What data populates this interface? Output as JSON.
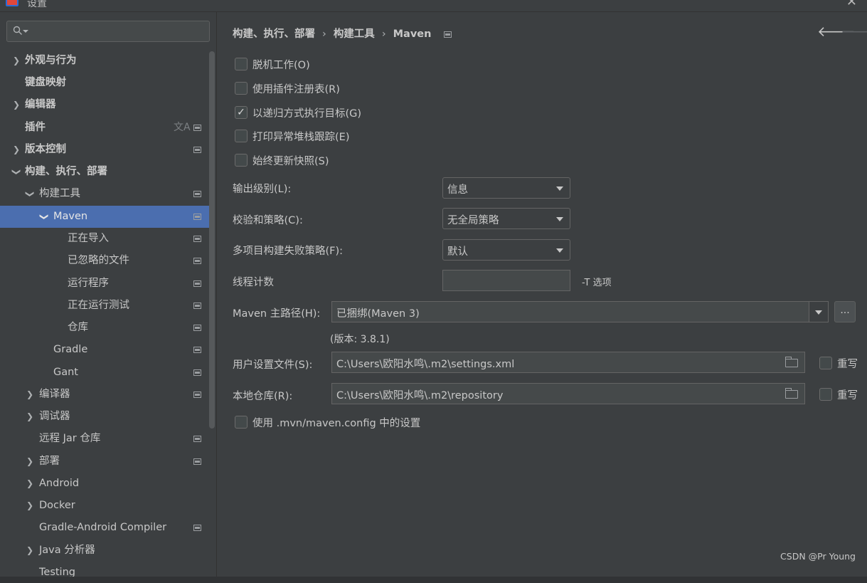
{
  "window": {
    "title": "设置"
  },
  "search": {
    "placeholder": ""
  },
  "sidebar": {
    "items": [
      {
        "label": "外观与行为",
        "bold": true,
        "chevron": "right"
      },
      {
        "label": "键盘映射",
        "bold": true,
        "chevron": ""
      },
      {
        "label": "编辑器",
        "bold": true,
        "chevron": "right"
      },
      {
        "label": "插件",
        "bold": true,
        "chevron": ""
      },
      {
        "label": "版本控制",
        "bold": true,
        "chevron": "right"
      },
      {
        "label": "构建、执行、部署",
        "bold": true,
        "chevron": "down"
      },
      {
        "label": "构建工具",
        "bold": false,
        "chevron": "down"
      },
      {
        "label": "Maven",
        "bold": false,
        "chevron": "down"
      },
      {
        "label": "正在导入",
        "bold": false,
        "chevron": ""
      },
      {
        "label": "已忽略的文件",
        "bold": false,
        "chevron": ""
      },
      {
        "label": "运行程序",
        "bold": false,
        "chevron": ""
      },
      {
        "label": "正在运行测试",
        "bold": false,
        "chevron": ""
      },
      {
        "label": "仓库",
        "bold": false,
        "chevron": ""
      },
      {
        "label": "Gradle",
        "bold": false,
        "chevron": ""
      },
      {
        "label": "Gant",
        "bold": false,
        "chevron": ""
      },
      {
        "label": "编译器",
        "bold": false,
        "chevron": "right"
      },
      {
        "label": "调试器",
        "bold": false,
        "chevron": "right"
      },
      {
        "label": "远程 Jar 仓库",
        "bold": false,
        "chevron": ""
      },
      {
        "label": "部署",
        "bold": false,
        "chevron": "right"
      },
      {
        "label": "Android",
        "bold": false,
        "chevron": "right"
      },
      {
        "label": "Docker",
        "bold": false,
        "chevron": "right"
      },
      {
        "label": "Gradle-Android Compiler",
        "bold": false,
        "chevron": ""
      },
      {
        "label": "Java 分析器",
        "bold": false,
        "chevron": "right"
      },
      {
        "label": "Testing",
        "bold": false,
        "chevron": ""
      }
    ]
  },
  "breadcrumb": {
    "part1": "构建、执行、部署",
    "sep": "›",
    "part2": "构建工具",
    "part3": "Maven"
  },
  "nav": {
    "back": "🡐",
    "forward": "🡒"
  },
  "options": {
    "offline": {
      "label": "脱机工作(O)",
      "checked": false
    },
    "plugin_registry": {
      "label": "使用插件注册表(R)",
      "checked": false
    },
    "recursive": {
      "label": "以递归方式执行目标(G)",
      "checked": true
    },
    "print_stack": {
      "label": "打印异常堆栈跟踪(E)",
      "checked": false
    },
    "always_update": {
      "label": "始终更新快照(S)",
      "checked": false
    }
  },
  "output_level": {
    "label": "输出级别(L):",
    "value": "信息"
  },
  "checksum": {
    "label": "校验和策略(C):",
    "value": "无全局策略"
  },
  "multiproject": {
    "label": "多项目构建失败策略(F):",
    "value": "默认"
  },
  "threads": {
    "label": "线程计数",
    "value": "",
    "hint": "-T 选项"
  },
  "maven_home": {
    "label": "Maven 主路径(H):",
    "value": "已捆绑(Maven 3)",
    "browse": "...",
    "version": "(版本: 3.8.1)"
  },
  "user_settings": {
    "label": "用户设置文件(S):",
    "value": "C:\\Users\\欧阳水鸣\\.m2\\settings.xml",
    "override": "重写"
  },
  "local_repo": {
    "label": "本地仓库(R):",
    "value": "C:\\Users\\欧阳水鸣\\.m2\\repository",
    "override": "重写"
  },
  "mvn_config": {
    "label": "使用 .mvn/maven.config 中的设置",
    "checked": false
  },
  "watermark": "CSDN @Pr Young",
  "check_mark": "✓"
}
